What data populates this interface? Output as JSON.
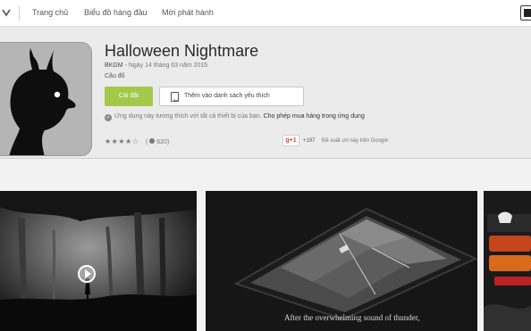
{
  "nav": {
    "items": [
      "Trang chủ",
      "Biểu đồ hàng đầu",
      "Mới phát hành"
    ]
  },
  "app": {
    "title": "Halloween Nightmare",
    "developer": "BKGM",
    "date": " - Ngày 14 tháng 03 năm 2015",
    "category": "Câu đố",
    "install_label": "Cài đặt",
    "wishlist_label": "Thêm vào danh sách yêu thích",
    "compat_text": "Ứng dụng này tương thích với tất cả thiết bị của bạn.",
    "iap_text": "Cho phép mua hàng trong ứng dụng",
    "rating_stars": "★★★★☆",
    "rating_count": "620",
    "gplus_label": "g+1",
    "gplus_count": "+197",
    "gplus_recommend": "Đề xuất ưri này trên Google"
  },
  "screenshots": {
    "caption": "After the overwhelming sound of thunder,"
  },
  "colors": {
    "accent": "#a3c94a"
  }
}
